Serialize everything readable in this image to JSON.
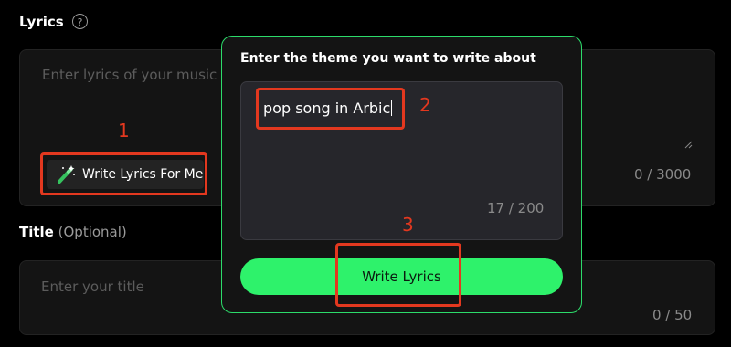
{
  "lyrics": {
    "label": "Lyrics",
    "help_icon": "question-circle-icon",
    "placeholder": "Enter lyrics of your music",
    "counter": "0 / 3000",
    "write_for_me_label": "Write Lyrics For Me",
    "write_for_me_icon": "magic-pen-icon"
  },
  "title": {
    "label": "Title",
    "optional": "(Optional)",
    "placeholder": "Enter your title",
    "counter": "0 / 50"
  },
  "modal": {
    "heading": "Enter the theme you want to write about",
    "theme_value": "pop song in Arbic",
    "counter": "17 / 200",
    "submit_label": "Write Lyrics"
  },
  "annotations": {
    "n1": "1",
    "n2": "2",
    "n3": "3",
    "color": "#e3381f"
  },
  "colors": {
    "accent": "#2ef26b",
    "modal_border": "#2cdb6a",
    "background": "#000000"
  }
}
